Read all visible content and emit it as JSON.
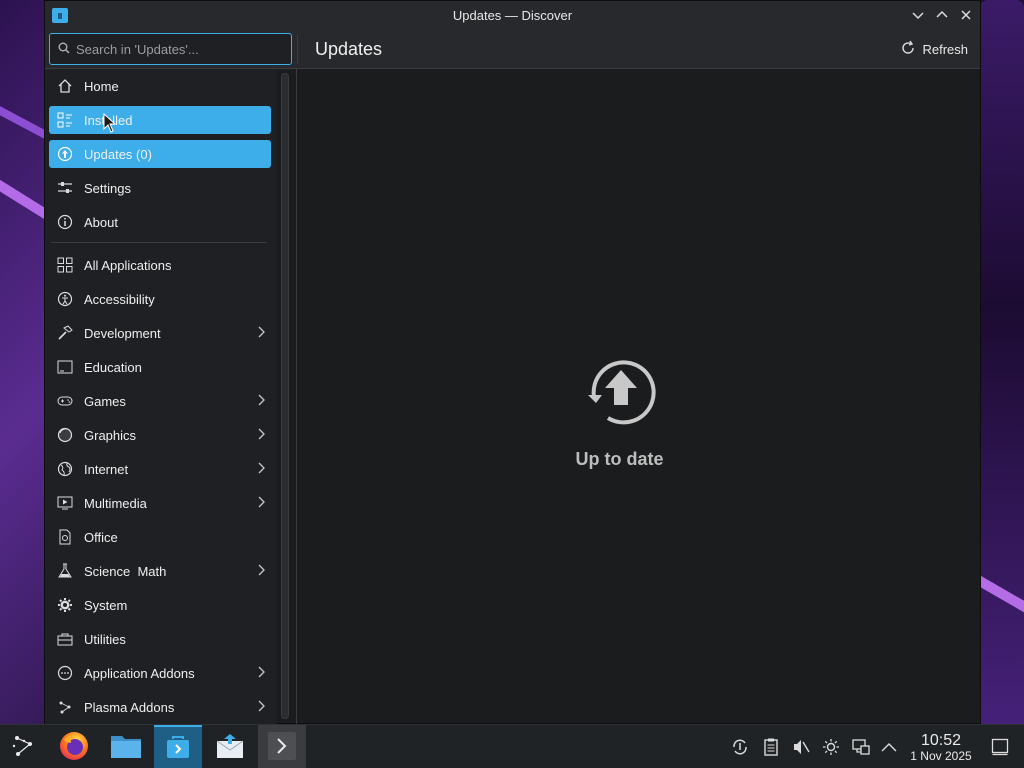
{
  "window": {
    "title": "Updates — Discover"
  },
  "search": {
    "placeholder": "Search in 'Updates'..."
  },
  "header": {
    "page_title": "Updates",
    "refresh_label": "Refresh"
  },
  "sidebar": {
    "top_items": [
      {
        "label": "Home",
        "icon": "home-icon"
      },
      {
        "label": "Installed",
        "icon": "installed-icon"
      },
      {
        "label": "Updates (0)",
        "icon": "updates-icon"
      },
      {
        "label": "Settings",
        "icon": "settings-icon"
      },
      {
        "label": "About",
        "icon": "info-icon"
      }
    ],
    "categories": [
      {
        "label": "All Applications",
        "icon": "grid-icon",
        "has_submenu": false
      },
      {
        "label": "Accessibility",
        "icon": "accessibility-icon",
        "has_submenu": false
      },
      {
        "label": "Development",
        "icon": "hammer-icon",
        "has_submenu": true
      },
      {
        "label": "Education",
        "icon": "education-icon",
        "has_submenu": false
      },
      {
        "label": "Games",
        "icon": "gamepad-icon",
        "has_submenu": true
      },
      {
        "label": "Graphics",
        "icon": "graphics-icon",
        "has_submenu": true
      },
      {
        "label": "Internet",
        "icon": "globe-icon",
        "has_submenu": true
      },
      {
        "label": "Multimedia",
        "icon": "multimedia-icon",
        "has_submenu": true
      },
      {
        "label": "Office",
        "icon": "office-icon",
        "has_submenu": false
      },
      {
        "label": "Science  Math",
        "icon": "flask-icon",
        "has_submenu": true
      },
      {
        "label": "System",
        "icon": "gear-icon",
        "has_submenu": false
      },
      {
        "label": "Utilities",
        "icon": "toolbox-icon",
        "has_submenu": false
      },
      {
        "label": "Application Addons",
        "icon": "addons-icon",
        "has_submenu": true
      },
      {
        "label": "Plasma Addons",
        "icon": "plasma-icon",
        "has_submenu": true
      }
    ]
  },
  "content": {
    "status_text": "Up to date"
  },
  "taskbar": {
    "time": "10:52",
    "date": "1 Nov 2025"
  },
  "colors": {
    "accent": "#3daee9",
    "window_bg": "#1b1c1e",
    "sidebar_bg": "#1e2023"
  }
}
